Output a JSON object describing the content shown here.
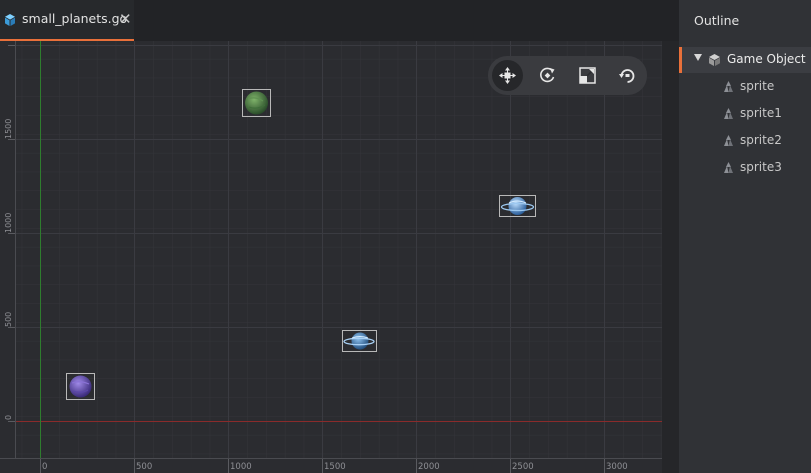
{
  "tab": {
    "title": "small_planets.go",
    "close_glyph": "✕",
    "icon": "game-object-icon"
  },
  "toolbar": {
    "tools": [
      {
        "name": "move-tool",
        "active": true
      },
      {
        "name": "rotate-tool",
        "active": false
      },
      {
        "name": "scale-tool",
        "active": false
      },
      {
        "name": "reset-view-tool",
        "active": false
      }
    ]
  },
  "viewport": {
    "x_axis_labels": [
      "0",
      "500",
      "1000",
      "1500",
      "2000",
      "2500",
      "3000"
    ],
    "y_axis_labels": [
      "0",
      "500",
      "1000",
      "1500"
    ],
    "sprites": [
      {
        "name": "sprite-green-planet",
        "style": "green-planet"
      },
      {
        "name": "sprite-ringed-planet-large",
        "style": "ringed-blue"
      },
      {
        "name": "sprite-ringed-planet-small",
        "style": "ringed-light"
      },
      {
        "name": "sprite-purple-planet",
        "style": "purple-planet"
      }
    ]
  },
  "outline": {
    "title": "Outline",
    "root": {
      "label": "Game Object",
      "icon": "cube-icon"
    },
    "items": [
      {
        "label": "sprite"
      },
      {
        "label": "sprite1"
      },
      {
        "label": "sprite2"
      },
      {
        "label": "sprite3"
      }
    ]
  },
  "colors": {
    "accent": "#e9703a",
    "x_axis": "#8a2b2b",
    "y_axis": "#2e7d2e"
  }
}
